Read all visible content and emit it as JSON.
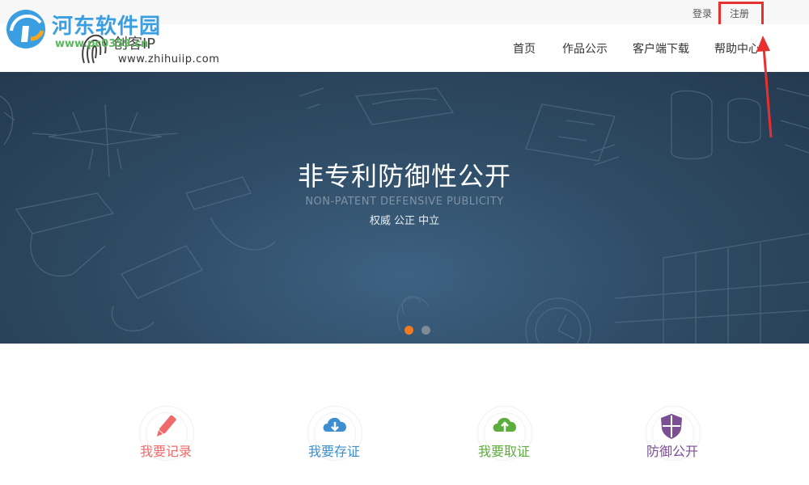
{
  "topbar": {
    "login": "登录",
    "register": "注册"
  },
  "watermark": {
    "title": "河东软件园",
    "url": "www.pc0359.cn"
  },
  "logo": {
    "name": "创客IP",
    "url": "www.zhihuiip.com"
  },
  "nav": {
    "items": [
      "首页",
      "作品公示",
      "客户端下载",
      "帮助中心"
    ]
  },
  "hero": {
    "title": "非专利防御性公开",
    "subtitle": "NON-PATENT DEFENSIVE PUBLICITY",
    "tagline": "权威 公正 中立",
    "active_slide": 1,
    "slide_count": 2
  },
  "features": [
    {
      "label": "我要记录",
      "icon": "pencil-icon",
      "color": "#ef6b6b"
    },
    {
      "label": "我要存证",
      "icon": "cloud-download-icon",
      "color": "#3d8fd1"
    },
    {
      "label": "我要取证",
      "icon": "cloud-upload-icon",
      "color": "#5cae3c"
    },
    {
      "label": "防御公开",
      "icon": "shield-icon",
      "color": "#7a4f93"
    }
  ],
  "colors": {
    "highlight": "#e8302f",
    "hero_bg": "#2f4c66",
    "dot_active": "#f07b22"
  }
}
